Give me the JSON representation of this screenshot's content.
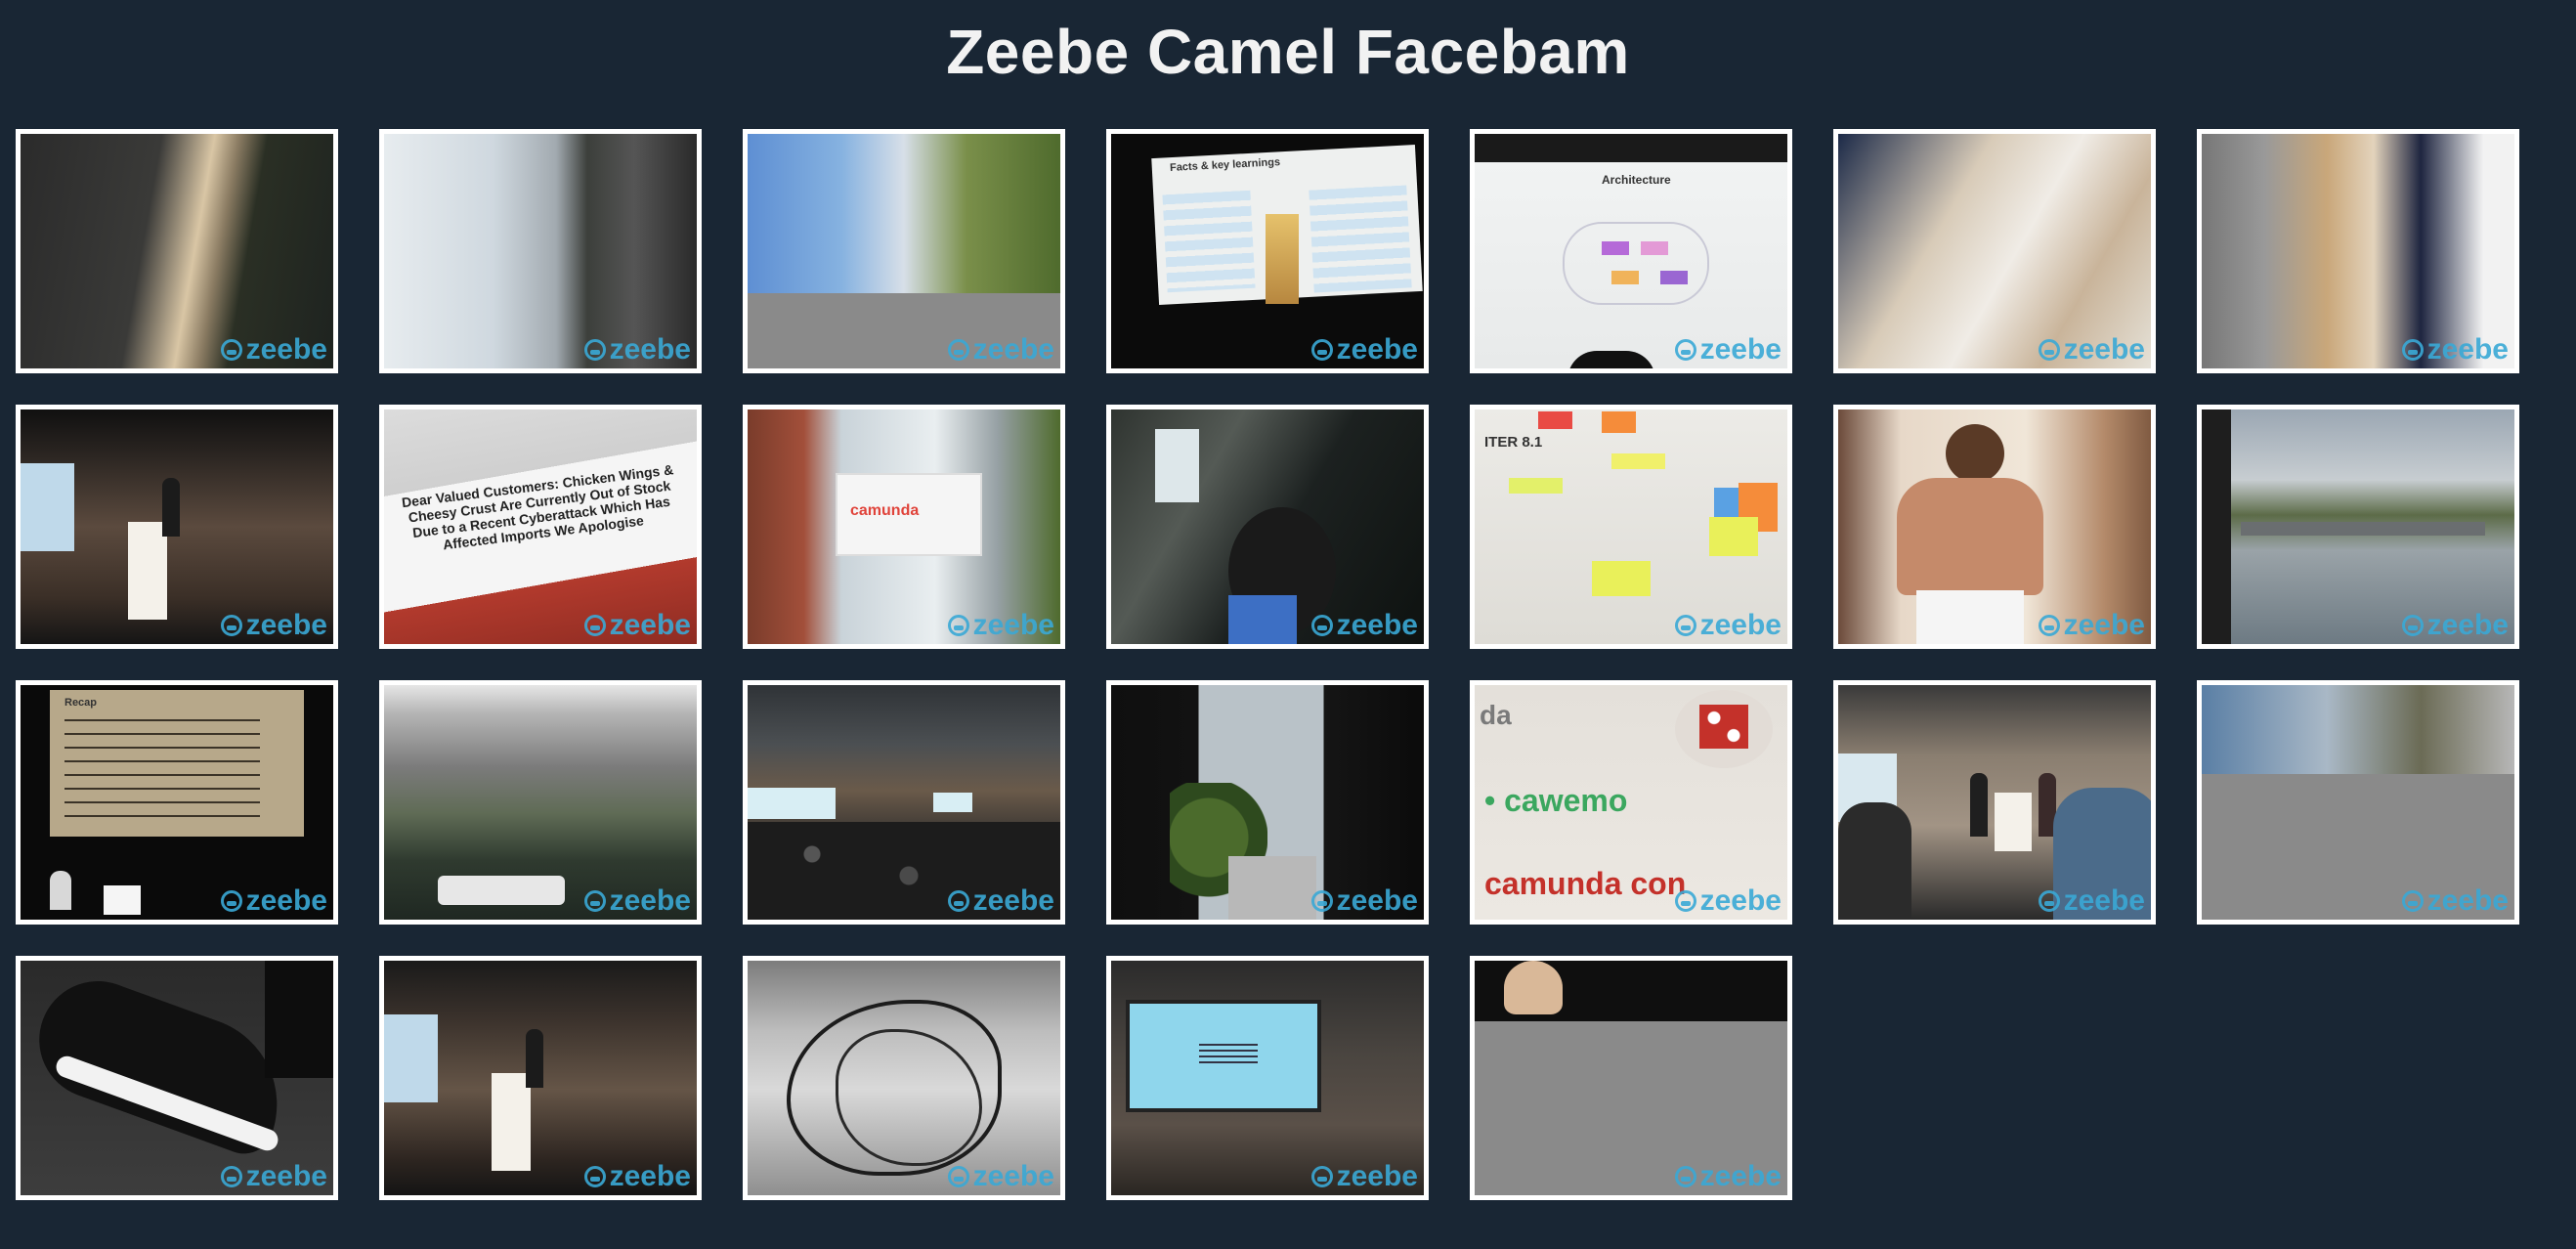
{
  "page": {
    "title": "Zeebe Camel Facebam"
  },
  "watermark": {
    "text": "zeebe",
    "color": "#3aa9d6",
    "icon": "zeebe-logo-icon"
  },
  "colors": {
    "background": "#192634",
    "title": "#f2f2f2",
    "frame": "#ffffff"
  },
  "photos": [
    {
      "id": 1,
      "scene": "rotated-room-window"
    },
    {
      "id": 2,
      "scene": "rotated-sky-river"
    },
    {
      "id": 3,
      "scene": "street-sky-partial"
    },
    {
      "id": 4,
      "scene": "slide-facts-key-learnings",
      "text": "Facts & key learnings"
    },
    {
      "id": 5,
      "scene": "slide-architecture",
      "text": "Architecture"
    },
    {
      "id": 6,
      "scene": "rotated-people"
    },
    {
      "id": 7,
      "scene": "rotated-person-window"
    },
    {
      "id": 8,
      "scene": "speaker-podium"
    },
    {
      "id": 9,
      "scene": "sign-notice",
      "text": "Dear Valued Customers: Chicken Wings & Cheesy Crust Are Currently Out of Stock Due to a Recent Cyberattack Which Has Affected Imports We Apologise"
    },
    {
      "id": 10,
      "scene": "building-banner",
      "text": "camunda"
    },
    {
      "id": 11,
      "scene": "rotated-dark-room"
    },
    {
      "id": 12,
      "scene": "whiteboard-sticky-notes",
      "text": "ITER 8.1"
    },
    {
      "id": 13,
      "scene": "poster-person"
    },
    {
      "id": 14,
      "scene": "river-reflection"
    },
    {
      "id": 15,
      "scene": "slide-recap",
      "text": "Recap"
    },
    {
      "id": 16,
      "scene": "river-boat"
    },
    {
      "id": 17,
      "scene": "audience-hall"
    },
    {
      "id": 18,
      "scene": "dark-window-tree"
    },
    {
      "id": 19,
      "scene": "cawemo-camundacon",
      "text1": "da",
      "text2": "cawemo",
      "text3": "camunda con"
    },
    {
      "id": 20,
      "scene": "stage-panel"
    },
    {
      "id": 21,
      "scene": "street-partial-grey"
    },
    {
      "id": 22,
      "scene": "sneaker"
    },
    {
      "id": 23,
      "scene": "speaker-podium-2"
    },
    {
      "id": 24,
      "scene": "cables"
    },
    {
      "id": 25,
      "scene": "screen-blue"
    },
    {
      "id": 26,
      "scene": "grey-partial-person"
    }
  ]
}
